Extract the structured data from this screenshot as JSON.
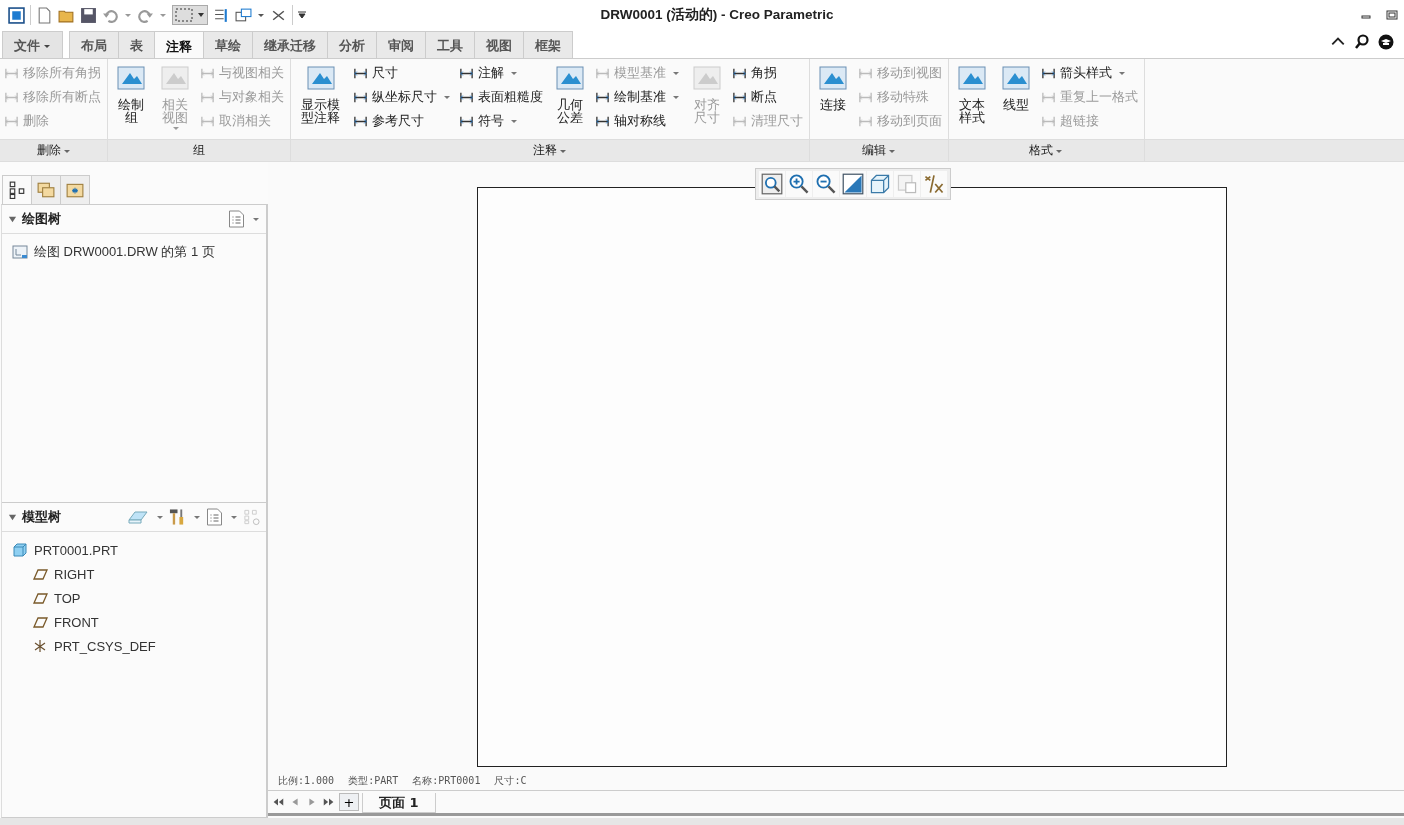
{
  "window": {
    "title": "DRW0001 (活动的) - Creo Parametric"
  },
  "tabs": [
    {
      "label": "文件",
      "selected": false,
      "kind": "menu"
    },
    {
      "label": "布局",
      "selected": false,
      "kind": "tab"
    },
    {
      "label": "表",
      "selected": false,
      "kind": "tab"
    },
    {
      "label": "注释",
      "selected": true,
      "kind": "tab"
    },
    {
      "label": "草绘",
      "selected": false,
      "kind": "tab"
    },
    {
      "label": "继承迁移",
      "selected": false,
      "kind": "tab"
    },
    {
      "label": "分析",
      "selected": false,
      "kind": "tab"
    },
    {
      "label": "审阅",
      "selected": false,
      "kind": "tab"
    },
    {
      "label": "工具",
      "selected": false,
      "kind": "tab"
    },
    {
      "label": "视图",
      "selected": false,
      "kind": "tab"
    },
    {
      "label": "框架",
      "selected": false,
      "kind": "tab"
    }
  ],
  "ribbon": [
    {
      "label": "删除",
      "dropdown": true,
      "columns": [
        {
          "kind": "small",
          "items": [
            {
              "label": "移除所有角拐",
              "disabled": true,
              "dropdown": false
            },
            {
              "label": "移除所有断点",
              "disabled": true,
              "dropdown": false
            },
            {
              "label": "删除",
              "disabled": true,
              "dropdown": false
            }
          ]
        }
      ]
    },
    {
      "label": "组",
      "dropdown": false,
      "columns": [
        {
          "kind": "large",
          "items": [
            {
              "label": "绘制组",
              "disabled": false,
              "dropdown": false
            }
          ]
        },
        {
          "kind": "large",
          "items": [
            {
              "label": "相关视图",
              "disabled": true,
              "dropdown": true
            }
          ]
        },
        {
          "kind": "small",
          "items": [
            {
              "label": "与视图相关",
              "disabled": true,
              "dropdown": false
            },
            {
              "label": "与对象相关",
              "disabled": true,
              "dropdown": false
            },
            {
              "label": "取消相关",
              "disabled": true,
              "dropdown": false
            }
          ]
        }
      ]
    },
    {
      "label": "注释",
      "dropdown": true,
      "columns": [
        {
          "kind": "large",
          "items": [
            {
              "label": "显示模型注释",
              "disabled": false,
              "dropdown": false
            }
          ]
        },
        {
          "kind": "small",
          "items": [
            {
              "label": "尺寸",
              "disabled": false,
              "dropdown": false
            },
            {
              "label": "纵坐标尺寸",
              "disabled": false,
              "dropdown": true
            },
            {
              "label": "参考尺寸",
              "disabled": false,
              "dropdown": false
            }
          ]
        },
        {
          "kind": "small",
          "items": [
            {
              "label": "注解",
              "disabled": false,
              "dropdown": true
            },
            {
              "label": "表面粗糙度",
              "disabled": false,
              "dropdown": false
            },
            {
              "label": "符号",
              "disabled": false,
              "dropdown": true
            }
          ]
        },
        {
          "kind": "large",
          "items": [
            {
              "label": "几何公差",
              "disabled": false,
              "dropdown": false
            }
          ]
        },
        {
          "kind": "small",
          "items": [
            {
              "label": "模型基准",
              "disabled": true,
              "dropdown": true
            },
            {
              "label": "绘制基准",
              "disabled": false,
              "dropdown": true
            },
            {
              "label": "轴对称线",
              "disabled": false,
              "dropdown": false
            }
          ]
        },
        {
          "kind": "large",
          "items": [
            {
              "label": "对齐尺寸",
              "disabled": true,
              "dropdown": false
            }
          ]
        },
        {
          "kind": "small",
          "items": [
            {
              "label": "角拐",
              "disabled": false,
              "dropdown": false
            },
            {
              "label": "断点",
              "disabled": false,
              "dropdown": false
            },
            {
              "label": "清理尺寸",
              "disabled": true,
              "dropdown": false
            }
          ]
        }
      ]
    },
    {
      "label": "编辑",
      "dropdown": true,
      "columns": [
        {
          "kind": "large",
          "items": [
            {
              "label": "连接",
              "disabled": false,
              "dropdown": false
            }
          ]
        },
        {
          "kind": "small",
          "items": [
            {
              "label": "移动到视图",
              "disabled": true,
              "dropdown": false
            },
            {
              "label": "移动特殊",
              "disabled": true,
              "dropdown": false
            },
            {
              "label": "移动到页面",
              "disabled": true,
              "dropdown": false
            }
          ]
        }
      ]
    },
    {
      "label": "格式",
      "dropdown": true,
      "columns": [
        {
          "kind": "large",
          "items": [
            {
              "label": "文本样式",
              "disabled": false,
              "dropdown": false
            }
          ]
        },
        {
          "kind": "large",
          "items": [
            {
              "label": "线型",
              "disabled": false,
              "dropdown": false
            }
          ]
        },
        {
          "kind": "small",
          "items": [
            {
              "label": "箭头样式",
              "disabled": false,
              "dropdown": true
            },
            {
              "label": "重复上一格式",
              "disabled": true,
              "dropdown": false
            },
            {
              "label": "超链接",
              "disabled": true,
              "dropdown": false
            }
          ]
        }
      ]
    }
  ],
  "drawing_tree": {
    "title": "绘图树",
    "items": [
      {
        "label": "绘图 DRW0001.DRW 的第 1 页"
      }
    ]
  },
  "model_tree": {
    "title": "模型树",
    "items": [
      {
        "label": "PRT0001.PRT",
        "kind": "part",
        "children": [
          {
            "label": "RIGHT",
            "kind": "plane"
          },
          {
            "label": "TOP",
            "kind": "plane"
          },
          {
            "label": "FRONT",
            "kind": "plane"
          },
          {
            "label": "PRT_CSYS_DEF",
            "kind": "csys"
          }
        ]
      }
    ]
  },
  "sheet_status": [
    "比例:1.000",
    "类型:PART",
    "名称:PRT0001",
    "尺寸:C"
  ],
  "page_bar": {
    "add": "+",
    "tabs": [
      {
        "label": "页面 1",
        "selected": true
      }
    ]
  }
}
